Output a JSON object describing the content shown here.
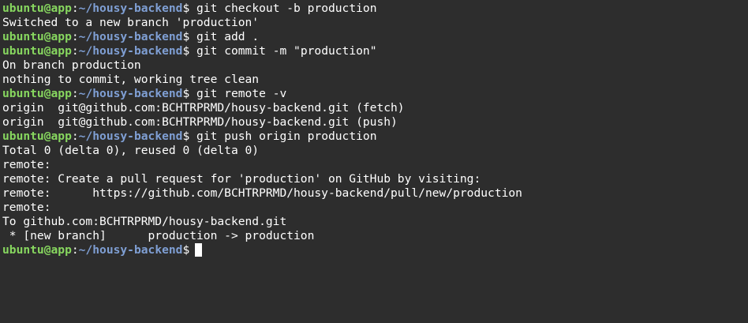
{
  "prompt": {
    "user_host": "ubuntu@app",
    "sep": ":",
    "path": "~/housy-backend",
    "dollar": "$"
  },
  "lines": [
    {
      "type": "cmd",
      "text": " git checkout -b production"
    },
    {
      "type": "out",
      "text": "Switched to a new branch 'production'"
    },
    {
      "type": "cmd",
      "text": " git add ."
    },
    {
      "type": "cmd",
      "text": " git commit -m \"production\""
    },
    {
      "type": "out",
      "text": "On branch production"
    },
    {
      "type": "out",
      "text": "nothing to commit, working tree clean"
    },
    {
      "type": "cmd",
      "text": " git remote -v"
    },
    {
      "type": "out",
      "text": "origin  git@github.com:BCHTRPRMD/housy-backend.git (fetch)"
    },
    {
      "type": "out",
      "text": "origin  git@github.com:BCHTRPRMD/housy-backend.git (push)"
    },
    {
      "type": "cmd",
      "text": " git push origin production"
    },
    {
      "type": "out",
      "text": "Total 0 (delta 0), reused 0 (delta 0)"
    },
    {
      "type": "out",
      "text": "remote:"
    },
    {
      "type": "out",
      "text": "remote: Create a pull request for 'production' on GitHub by visiting:"
    },
    {
      "type": "out",
      "text": "remote:      https://github.com/BCHTRPRMD/housy-backend/pull/new/production"
    },
    {
      "type": "out",
      "text": "remote:"
    },
    {
      "type": "out",
      "text": "To github.com:BCHTRPRMD/housy-backend.git"
    },
    {
      "type": "out",
      "text": " * [new branch]      production -> production"
    },
    {
      "type": "cmd",
      "text": "",
      "cursor": true
    }
  ],
  "colors": {
    "background": "#2d2d2d",
    "prompt_user": "#87d75f",
    "prompt_path": "#7f9fd4",
    "text": "#ffffff"
  }
}
